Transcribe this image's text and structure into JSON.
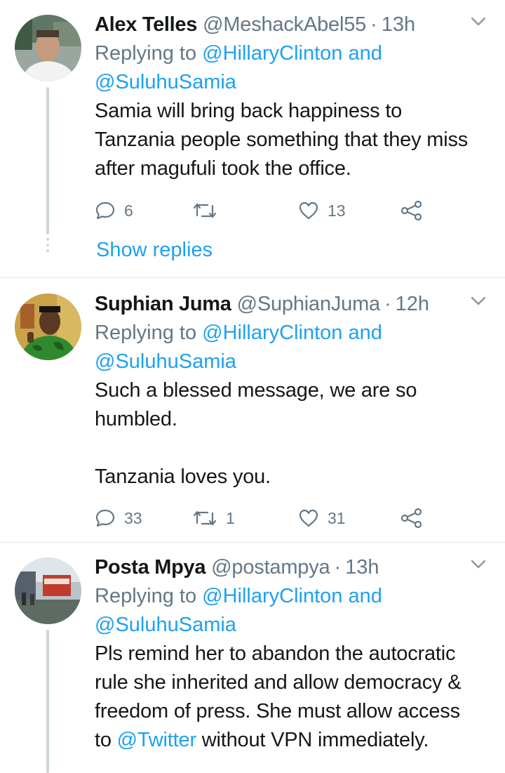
{
  "tweets": [
    {
      "name": "Alex Telles",
      "handle": "@MeshackAbel55",
      "separator": "·",
      "time": "13h",
      "replying_prefix": "Replying to",
      "reply_to_1": "@HillaryClinton",
      "reply_and": "and",
      "reply_to_2": "@SuluhuSamia",
      "text_lines": [
        "Samia will bring back  happiness to",
        "Tanzania people something that they miss",
        "after magufuli took the office."
      ],
      "replies": "6",
      "retweets": "",
      "likes": "13",
      "show_replies": "Show replies"
    },
    {
      "name": "Suphian Juma",
      "handle": "@SuphianJuma",
      "separator": "·",
      "time": "12h",
      "replying_prefix": "Replying to",
      "reply_to_1": "@HillaryClinton",
      "reply_and": "and",
      "reply_to_2": "@SuluhuSamia",
      "text_lines": [
        "Such a blessed message, we are so",
        "humbled.",
        "",
        "Tanzania loves you."
      ],
      "replies": "33",
      "retweets": "1",
      "likes": "31"
    },
    {
      "name": "Posta Mpya",
      "handle": "@postampya",
      "separator": "·",
      "time": "13h",
      "replying_prefix": "Replying to",
      "reply_to_1": "@HillaryClinton",
      "reply_and": "and",
      "reply_to_2": "@SuluhuSamia",
      "text_lines": [
        "Pls remind her to abandon the autocratic",
        "rule she inherited and allow democracy &",
        "freedom of press. She must allow access"
      ],
      "text_last_prefix": "to",
      "text_last_mention": "@Twitter",
      "text_last_suffix": "without VPN immediately."
    }
  ],
  "colors": {
    "link": "#1da1f2",
    "secondary": "#657786",
    "primary": "#14171a",
    "divider": "#e1e8ed",
    "thread": "#ccd6dd"
  },
  "icons": {
    "menu": "chevron-down-icon",
    "reply": "reply-bubble-icon",
    "retweet": "retweet-icon",
    "like": "heart-icon",
    "share": "share-icon"
  }
}
